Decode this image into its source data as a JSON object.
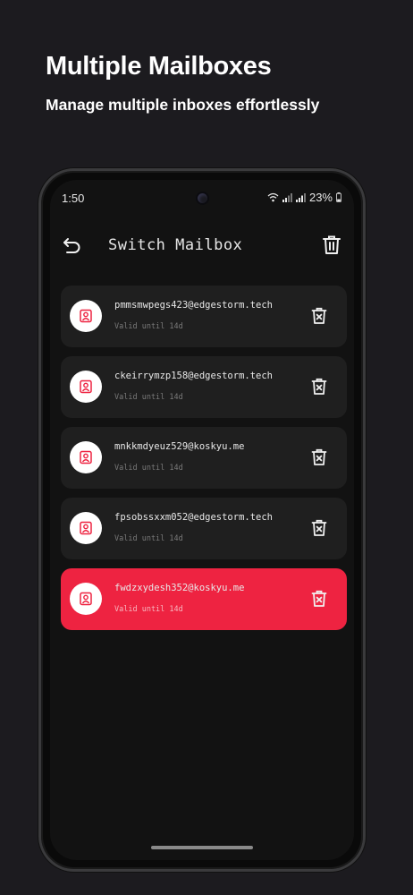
{
  "promo": {
    "title": "Multiple Mailboxes",
    "subtitle": "Manage multiple inboxes effortlessly"
  },
  "status_bar": {
    "time": "1:50",
    "battery": "23%"
  },
  "header": {
    "title": "Switch Mailbox",
    "back_icon": "back-arrow-icon",
    "delete_all_icon": "trash-icon"
  },
  "mailboxes": [
    {
      "email": "pmmsmwpegs423@edgestorm.tech",
      "validity": "Valid until 14d",
      "active": false
    },
    {
      "email": "ckeirrymzp158@edgestorm.tech",
      "validity": "Valid until 14d",
      "active": false
    },
    {
      "email": "mnkkmdyeuz529@koskyu.me",
      "validity": "Valid until 14d",
      "active": false
    },
    {
      "email": "fpsobssxxm052@edgestorm.tech",
      "validity": "Valid until 14d",
      "active": false
    },
    {
      "email": "fwdzxydesh352@koskyu.me",
      "validity": "Valid until 14d",
      "active": true
    }
  ],
  "colors": {
    "accent": "#ee2341",
    "card": "#1f1f1f",
    "background": "#1c1b1f",
    "screen": "#121212"
  }
}
